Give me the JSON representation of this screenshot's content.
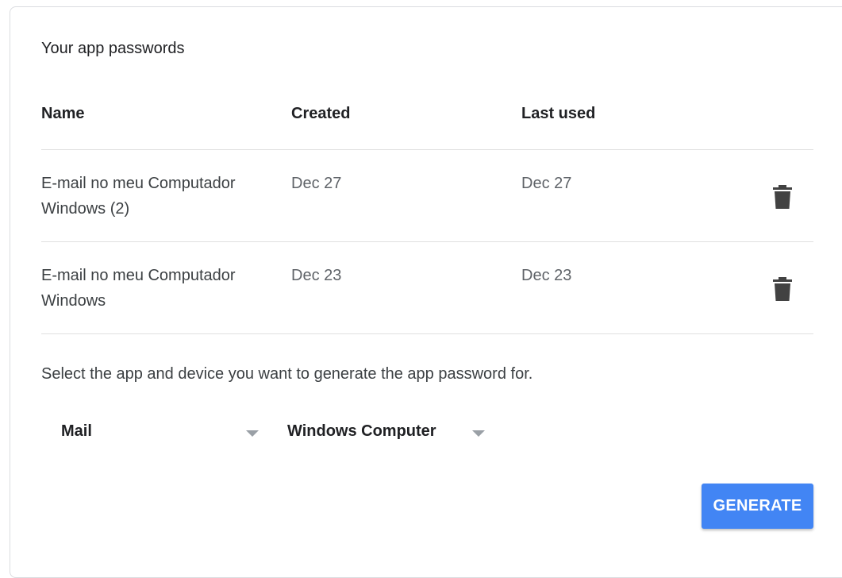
{
  "section": {
    "title": "Your app passwords"
  },
  "table": {
    "headers": {
      "name": "Name",
      "created": "Created",
      "last_used": "Last used"
    },
    "rows": [
      {
        "name": "E-mail no meu Computador Windows (2)",
        "created": "Dec 27",
        "last_used": "Dec 27",
        "delete_icon": "trash-icon"
      },
      {
        "name": "E-mail no meu Computador Windows",
        "created": "Dec 23",
        "last_used": "Dec 23",
        "delete_icon": "trash-icon"
      }
    ]
  },
  "generator": {
    "instruction": "Select the app and device you want to generate the app password for.",
    "app_select": "Mail",
    "device_select": "Windows Computer",
    "button_label": "GENERATE"
  },
  "colors": {
    "accent": "#4285f4",
    "icon": "#424242",
    "divider": "#e0e0e0"
  }
}
